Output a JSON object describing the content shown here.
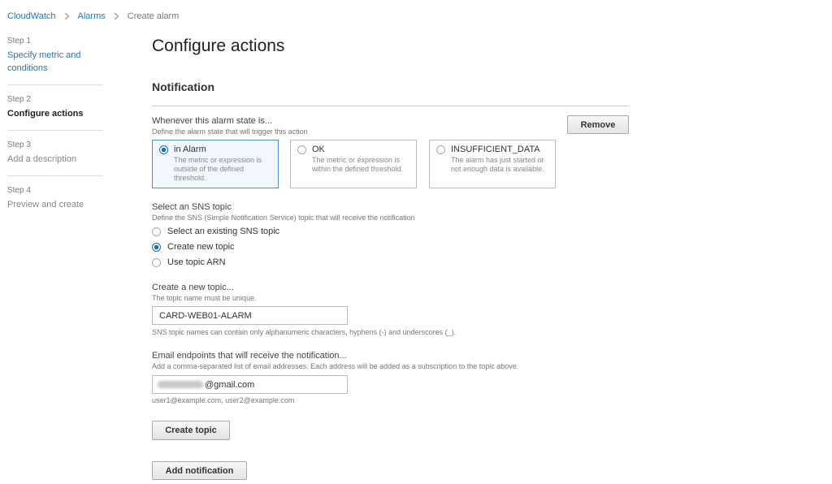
{
  "breadcrumb": {
    "items": [
      "CloudWatch",
      "Alarms"
    ],
    "current": "Create alarm"
  },
  "steps": [
    {
      "num": "Step 1",
      "title": "Specify metric and conditions",
      "state": "done"
    },
    {
      "num": "Step 2",
      "title": "Configure actions",
      "state": "active"
    },
    {
      "num": "Step 3",
      "title": "Add a description",
      "state": "pending"
    },
    {
      "num": "Step 4",
      "title": "Preview and create",
      "state": "pending"
    }
  ],
  "page": {
    "title": "Configure actions",
    "section_title": "Notification"
  },
  "alarm_state": {
    "label": "Whenever this alarm state is...",
    "hint": "Define the alarm state that will trigger this action",
    "remove_label": "Remove",
    "options": [
      {
        "title": "in Alarm",
        "desc": "The metric or expression is outside of the defined threshold.",
        "selected": true
      },
      {
        "title": "OK",
        "desc": "The metric or expression is within the defined threshold.",
        "selected": false
      },
      {
        "title": "INSUFFICIENT_DATA",
        "desc": "The alarm has just started or not enough data is available.",
        "selected": false
      }
    ]
  },
  "sns": {
    "label": "Select an SNS topic",
    "hint": "Define the SNS (Simple Notification Service) topic that will receive the notification",
    "options": [
      {
        "label": "Select an existing SNS topic",
        "selected": false
      },
      {
        "label": "Create new topic",
        "selected": true
      },
      {
        "label": "Use topic ARN",
        "selected": false
      }
    ]
  },
  "new_topic": {
    "label": "Create a new topic...",
    "hint": "The topic name must be unique.",
    "value": "CARD-WEB01-ALARM",
    "help": "SNS topic names can contain only alphanumeric characters, hyphens (-) and underscores (_)."
  },
  "email": {
    "label": "Email endpoints that will receive the notification...",
    "hint": "Add a comma-separated list of email addresses. Each address will be added as a subscription to the topic above.",
    "value_suffix": "@gmail.com",
    "example": "user1@example.com, user2@example.com"
  },
  "buttons": {
    "create_topic": "Create topic",
    "add_notification": "Add notification"
  },
  "colors": {
    "link": "#2a73b5",
    "selected_border": "#4a90c8",
    "radio_checked": "#1f6fb5"
  }
}
